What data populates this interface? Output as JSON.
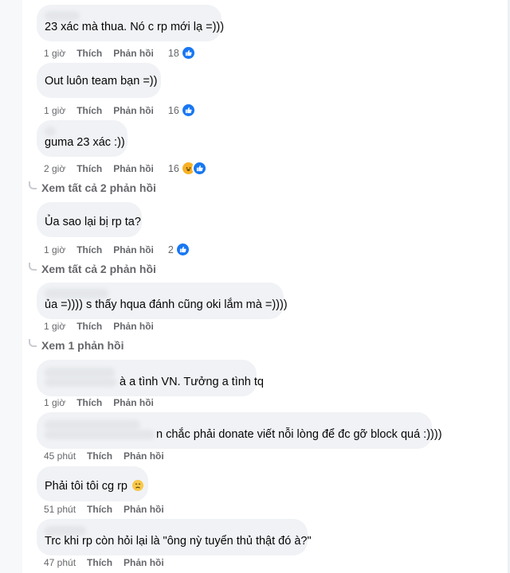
{
  "comments": [
    {
      "text": "23 xác mà thua. Nó c  rp mới lạ =)))",
      "time": "1 giờ",
      "like": "Thích",
      "reply": "Phản hồi",
      "reaction_count": "18",
      "reactions": [
        "like"
      ]
    },
    {
      "text": "Out luôn team bạn =))",
      "time": "1 giờ",
      "like": "Thích",
      "reply": "Phản hồi",
      "reaction_count": "16",
      "reactions": [
        "like"
      ]
    },
    {
      "text": "guma 23 xác :))",
      "time": "2 giờ",
      "like": "Thích",
      "reply": "Phản hồi",
      "reaction_count": "16",
      "reactions": [
        "haha",
        "like"
      ]
    },
    {
      "text": "Ủa sao lại bị rp ta?",
      "time": "1 giờ",
      "like": "Thích",
      "reply": "Phản hồi",
      "reaction_count": "2",
      "reactions": [
        "like"
      ]
    },
    {
      "text": "ủa =)))) s thấy hqua đánh cũng oki lắm mà =))))",
      "time": "1 giờ",
      "like": "Thích",
      "reply": "Phản hồi",
      "reaction_count": "",
      "reactions": []
    },
    {
      "text": "à a tình VN. Tưởng a tình tq",
      "time": "1 giờ",
      "like": "Thích",
      "reply": "Phản hồi",
      "reaction_count": "",
      "reactions": []
    },
    {
      "text": "n chắc phải donate viết nỗi lòng để đc gỡ block quá :))))",
      "time": "45 phút",
      "like": "Thích",
      "reply": "Phản hồi",
      "reaction_count": "",
      "reactions": []
    },
    {
      "text": "Phải tôi tôi cg rp",
      "time": "51 phút",
      "like": "Thích",
      "reply": "Phản hồi",
      "reaction_count": "",
      "reactions": []
    },
    {
      "text": "Trc khi rp còn hỏi lại là \"ông nỳ tuyển thủ thật đó à?\"",
      "time": "47 phút",
      "like": "Thích",
      "reply": "Phản hồi",
      "reaction_count": "",
      "reactions": []
    }
  ],
  "view_replies": [
    "Xem tất cả 2 phản hồi",
    "Xem tất cả 2 phản hồi",
    "Xem 1 phản hồi"
  ],
  "colors": {
    "bubble": "#f0f2f5",
    "meta": "#65676b",
    "like_reaction": "#1877f2",
    "haha_reaction": "#f7b125"
  },
  "icons": {
    "like": "thumbs-up-icon",
    "haha": "laughing-face-icon",
    "sad": "sad-face-icon"
  }
}
